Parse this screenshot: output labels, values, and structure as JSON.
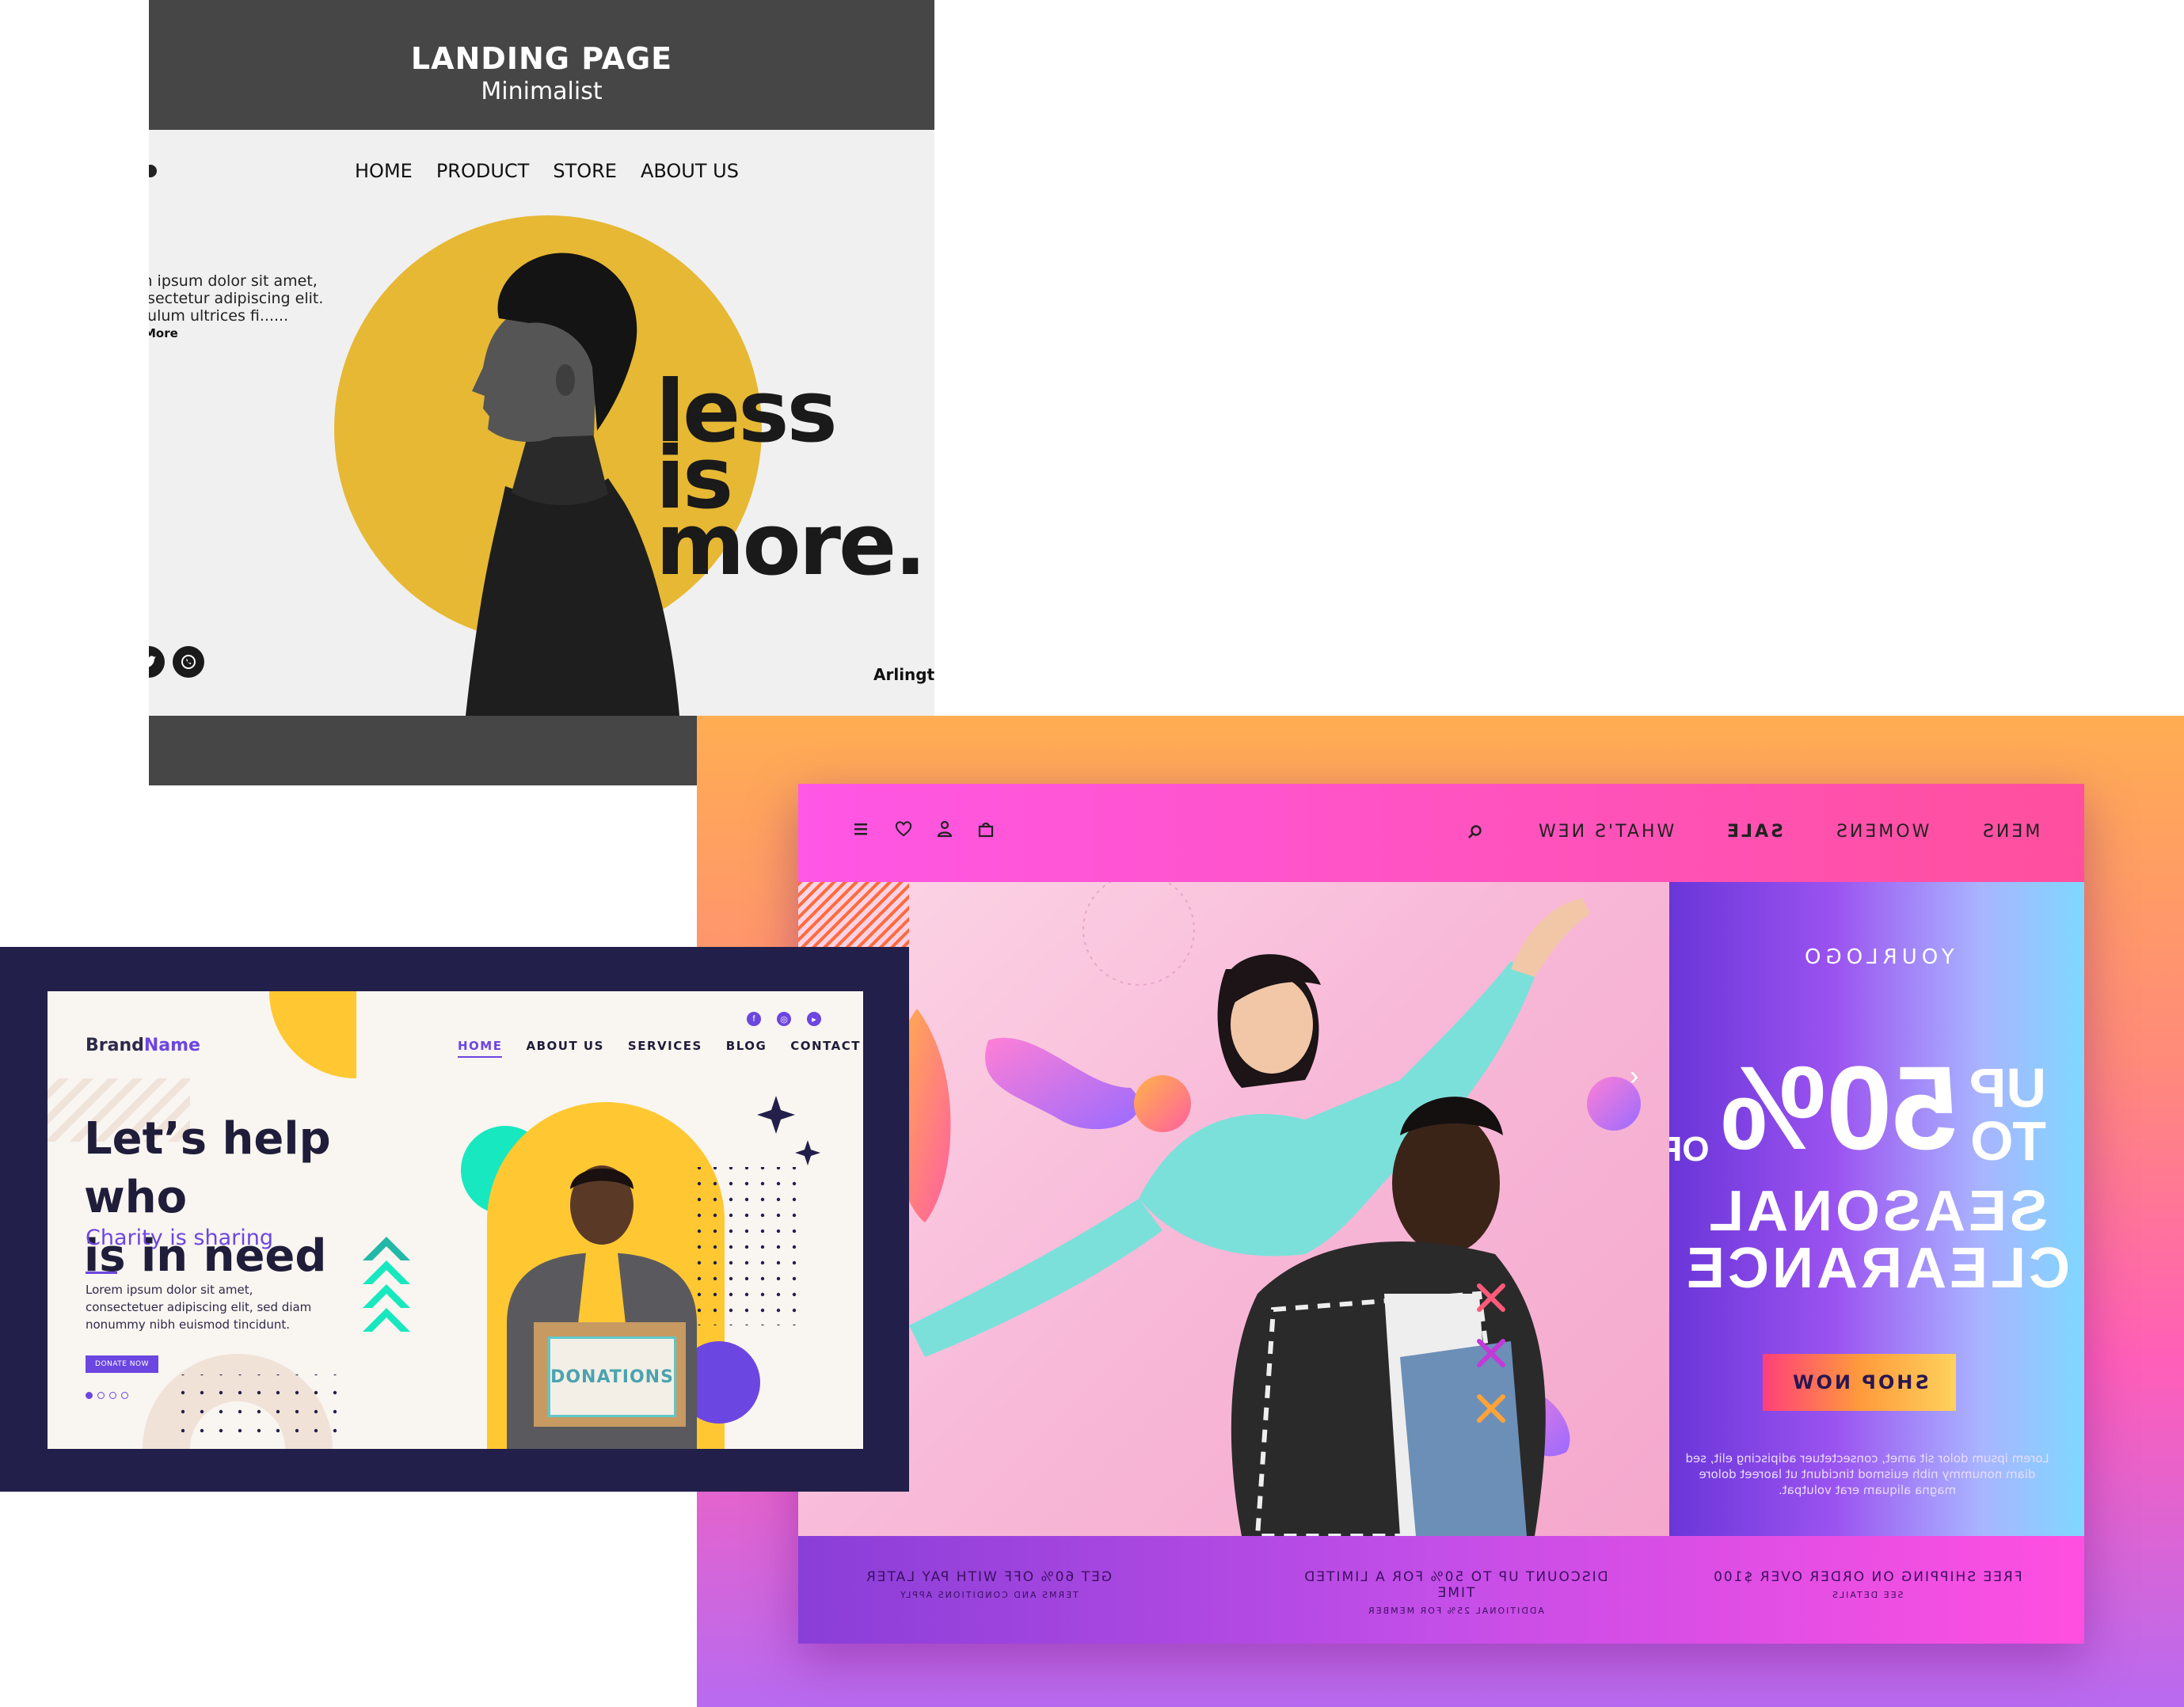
{
  "minimalist": {
    "title": "LANDING PAGE",
    "subtitle": "Minimalist",
    "nav": [
      "HOME",
      "PRODUCT",
      "STORE",
      "ABOUT US"
    ],
    "body_text": "m ipsum dolor sit amet, nsectetur adipiscing elit. pulum ultrices fi......",
    "read_more": "More",
    "headline_line1": "less is",
    "headline_line2": "more.",
    "footer_text": "Arlingto",
    "social_icons": [
      "twitter-icon",
      "whatsapp-icon"
    ],
    "accent_color": "#e6b834"
  },
  "fashion": {
    "nav_items": [
      "MENS",
      "WOMENS",
      "SALE",
      "WHAT'S NEW"
    ],
    "icons": [
      "menu-icon",
      "heart-icon",
      "user-icon",
      "bag-icon",
      "search-icon"
    ],
    "logo": "YOURLOGO",
    "promo_up": "UP",
    "promo_to": "TO",
    "promo_pct": "50%",
    "promo_off": "OFF",
    "promo_line1": "SEASONAL",
    "promo_line2": "CLEARANCE",
    "shop_button": "SHOP NOW",
    "fine_print": "Lorem ipsum dolor sit amet, consectetuer adipiscing elit, sed diam nonummy nibh euismod tincidunt ut laoreet dolore magna aliquam erat volutpat.",
    "footer": [
      {
        "title": "FREE SHIPPING ON ORDER OVER $100",
        "sub": "SEE DETAILS"
      },
      {
        "title": "DISCOUNT UP TO 50% FOR A LIMITED TIME",
        "sub": "ADDITIONAL 25% FOR MEMBER"
      },
      {
        "title": "GET 60% OFF WITH PAY LATER",
        "sub": "TERMS AND CONDITIONS APPLY"
      }
    ]
  },
  "charity": {
    "brand_a": "Brand",
    "brand_b": "Name",
    "nav": [
      "HOME",
      "ABOUT US",
      "SERVICES",
      "BLOG",
      "CONTACT"
    ],
    "headline_line1": "Let’s help who",
    "headline_line2": "is in need",
    "subheadline": "Charity is sharing",
    "body": "Lorem ipsum dolor sit amet, consectetuer adipiscing elit, sed diam nonummy nibh euismod tincidunt.",
    "button": "DONATE NOW",
    "box_label": "DONATIONS",
    "accent_color": "#6c46e0"
  }
}
